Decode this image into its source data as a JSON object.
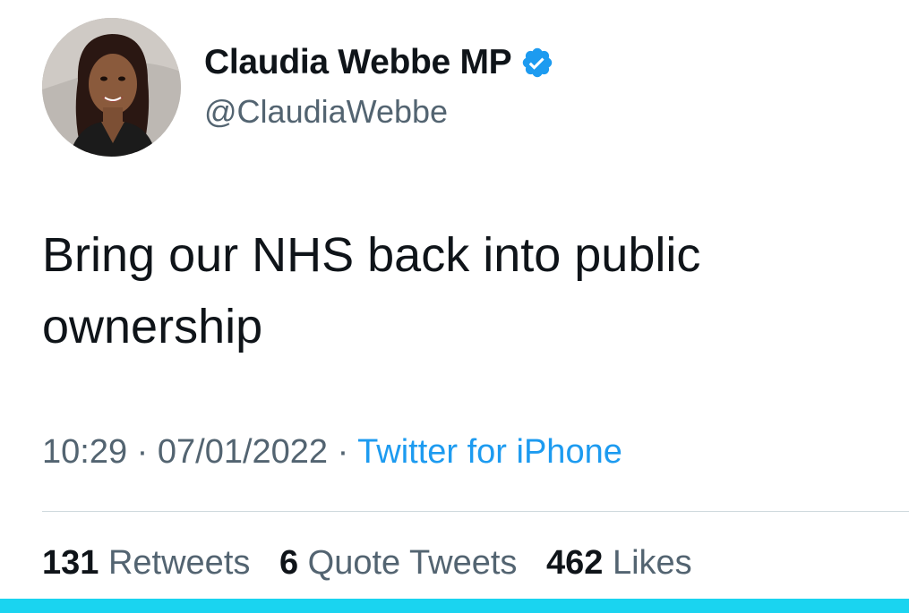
{
  "author": {
    "display_name": "Claudia Webbe MP",
    "handle": "@ClaudiaWebbe",
    "verified": true,
    "avatar_icon": "profile-photo"
  },
  "tweet": {
    "text": "Bring our NHS back into public ownership",
    "time": "10:29",
    "separator": "·",
    "date": "07/01/2022",
    "source": "Twitter for iPhone"
  },
  "stats": {
    "retweets_count": "131",
    "retweets_label": "Retweets",
    "quote_tweets_count": "6",
    "quote_tweets_label": "Quote Tweets",
    "likes_count": "462",
    "likes_label": "Likes"
  },
  "colors": {
    "accent": "#1d9bf0",
    "secondary_text": "#536471",
    "primary_text": "#0f1419",
    "bottom_bar": "#1ad4f0"
  }
}
